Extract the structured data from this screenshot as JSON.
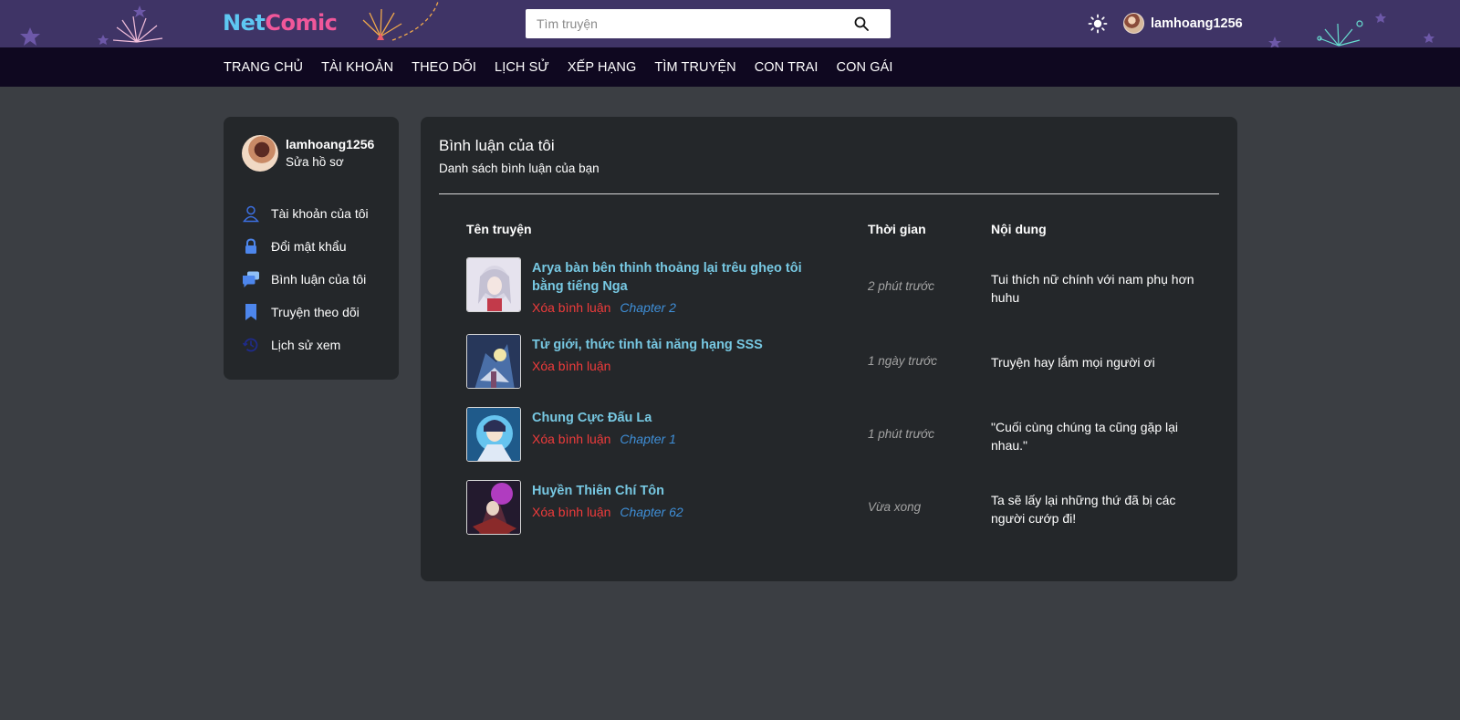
{
  "header": {
    "logo_part1": "Net",
    "logo_part2": "Comic",
    "search_placeholder": "Tìm truyện",
    "username": "lamhoang1256",
    "icons": {
      "search": "search-icon",
      "theme": "sun-icon"
    }
  },
  "nav": {
    "items": [
      "TRANG CHỦ",
      "TÀI KHOẢN",
      "THEO DÕI",
      "LỊCH SỬ",
      "XẾP HẠNG",
      "TÌM TRUYỆN",
      "CON TRAI",
      "CON GÁI"
    ]
  },
  "sidebar": {
    "username": "lamhoang1256",
    "edit_profile": "Sửa hồ sơ",
    "items": [
      {
        "label": "Tài khoản của tôi",
        "icon": "user-icon"
      },
      {
        "label": "Đổi mật khẩu",
        "icon": "lock-icon"
      },
      {
        "label": "Bình luận của tôi",
        "icon": "comment-icon"
      },
      {
        "label": "Truyện theo dõi",
        "icon": "bookmark-icon"
      },
      {
        "label": "Lịch sử xem",
        "icon": "history-icon"
      }
    ]
  },
  "main": {
    "title": "Bình luận của tôi",
    "subtitle": "Danh sách bình luận của bạn",
    "columns": [
      "Tên truyện",
      "Thời gian",
      "Nội dung"
    ],
    "rows": [
      {
        "title": "Arya bàn bên thỉnh thoảng lại trêu ghẹo tôi bằng tiếng Nga",
        "delete": "Xóa bình luận",
        "chapter": "Chapter 2",
        "time": "2 phút trước",
        "content": "Tui thích nữ chính với nam phụ hơn huhu"
      },
      {
        "title": "Tử giới, thức tỉnh tài năng hạng SSS",
        "delete": "Xóa bình luận",
        "chapter": "",
        "time": "1 ngày trước",
        "content": "Truyện hay lắm mọi người ơi"
      },
      {
        "title": "Chung Cực Đấu La",
        "delete": "Xóa bình luận",
        "chapter": "Chapter 1",
        "time": "1 phút trước",
        "content": "\"Cuối cùng chúng ta cũng gặp lại nhau.\""
      },
      {
        "title": "Huyền Thiên Chí Tôn",
        "delete": "Xóa bình luận",
        "chapter": "Chapter 62",
        "time": "Vừa xong",
        "content": "Ta sẽ lấy lại những thứ đã bị các người cướp đi!"
      }
    ]
  },
  "colors": {
    "topbar": "#3f3466",
    "nav": "#0f0820",
    "background": "#3b3e43",
    "panel": "#24272a",
    "link": "#77c8e2",
    "delete": "#ef3b3b",
    "chapter": "#3f8fd8"
  }
}
